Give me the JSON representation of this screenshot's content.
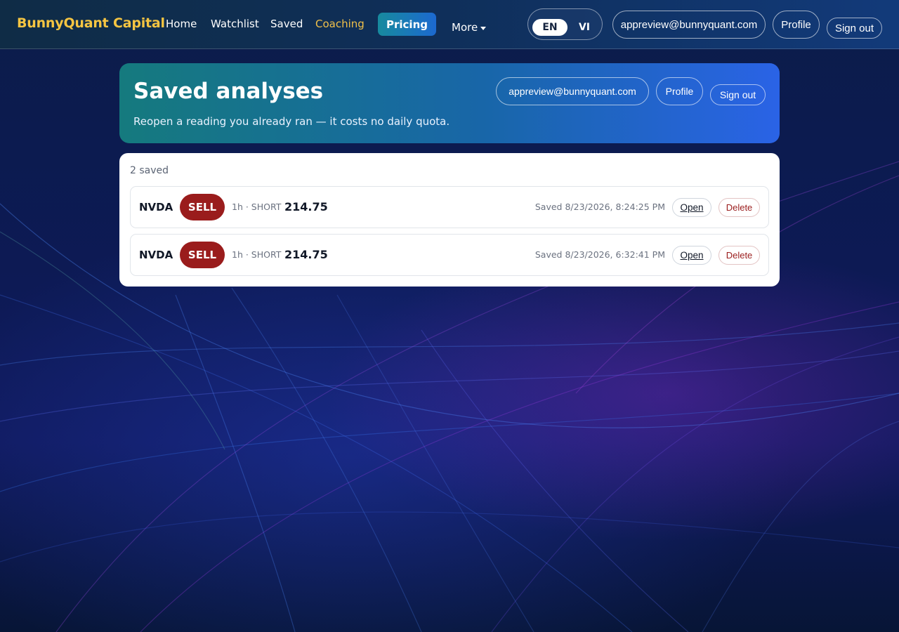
{
  "nav": {
    "brand": "BunnyQuant Capital",
    "links": {
      "home": "Home",
      "watchlist": "Watchlist",
      "saved": "Saved",
      "coaching": "Coaching"
    },
    "pricing": "Pricing",
    "more": "More",
    "lang": {
      "en": "EN",
      "vi": "VI"
    },
    "email": "appreview@bunnyquant.com",
    "profile": "Profile",
    "signout": "Sign out"
  },
  "hero": {
    "title": "Saved analyses",
    "subtitle": "Reopen a reading you already ran — it costs no daily quota.",
    "email": "appreview@bunnyquant.com",
    "profile": "Profile",
    "signout": "Sign out"
  },
  "saved": {
    "count_label": "2 saved",
    "open_label": "Open",
    "delete_label": "Delete",
    "items": [
      {
        "ticker": "NVDA",
        "signal": "SELL",
        "meta": "1h · SHORT",
        "price": "214.75",
        "saved_at": "Saved 8/23/2026, 8:24:25 PM"
      },
      {
        "ticker": "NVDA",
        "signal": "SELL",
        "meta": "1h · SHORT",
        "price": "214.75",
        "saved_at": "Saved 8/23/2026, 6:32:41 PM"
      }
    ]
  },
  "colors": {
    "brand": "#f5c542",
    "coaching": "#f0c04a",
    "sell": "#9a1c1c",
    "hero_start": "#157a7e",
    "hero_end": "#2a63e6"
  }
}
